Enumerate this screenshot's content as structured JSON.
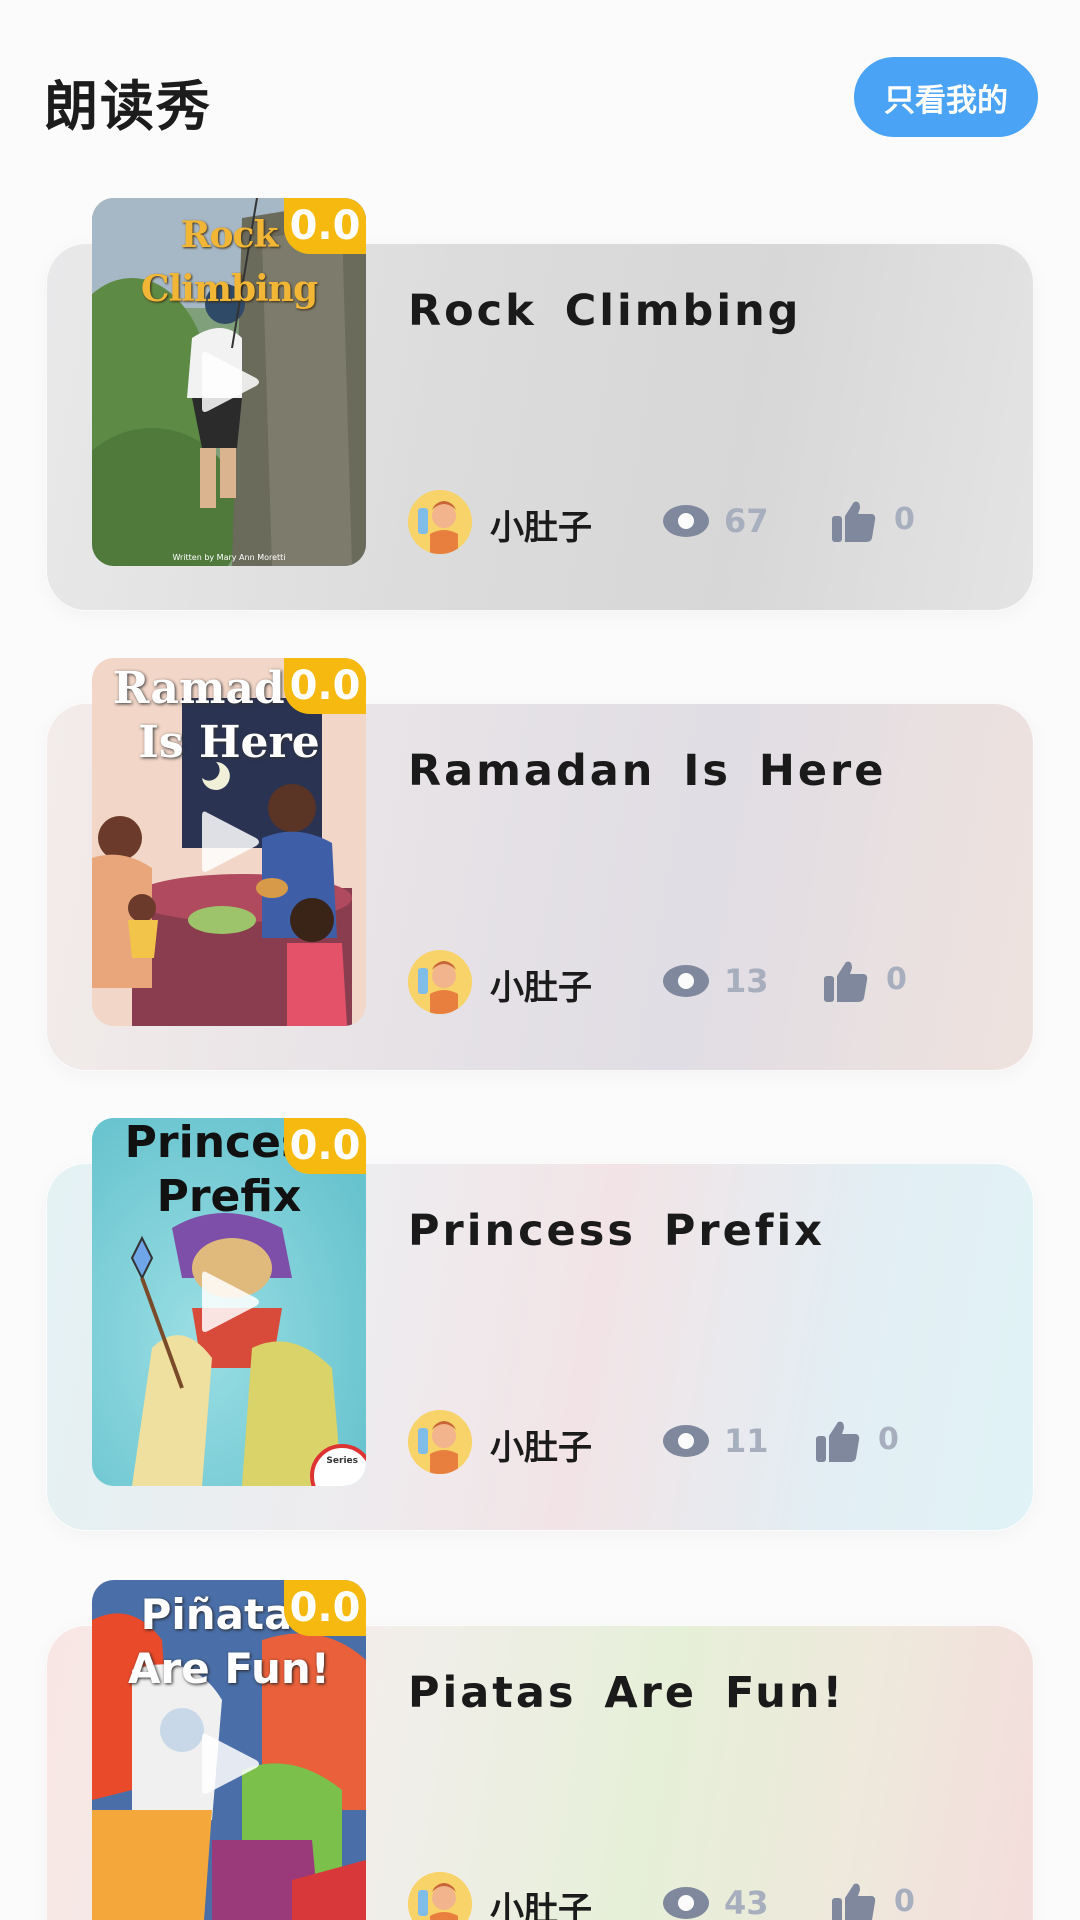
{
  "header": {
    "title": "朗读秀",
    "mine_button_label": "只看我的"
  },
  "colors": {
    "accent_blue": "#4aa3f5",
    "score_badge": "#f6b90f",
    "stat_gray": "#a7afbf"
  },
  "items": [
    {
      "book_title": "Rock Climbing",
      "cover_text": "Rock Climbing",
      "cover_credit": "Written by Mary Ann Moretti",
      "score": "0.0",
      "user_name": "小肚子",
      "views": "67",
      "likes": "0"
    },
    {
      "book_title": "Ramadan Is Here",
      "cover_text": "Ramadan\nIs Here",
      "score": "0.0",
      "user_name": "小肚子",
      "views": "13",
      "likes": "0"
    },
    {
      "book_title": "Princess Prefix",
      "cover_text": "Princess\nPrefix",
      "cover_badge": "Series",
      "score": "0.0",
      "user_name": "小肚子",
      "views": "11",
      "likes": "0"
    },
    {
      "book_title": "Piatas Are Fun!",
      "cover_text": "Piñatas\nAre Fun!",
      "score": "0.0",
      "user_name": "小肚子",
      "views": "43",
      "likes": "0"
    }
  ]
}
